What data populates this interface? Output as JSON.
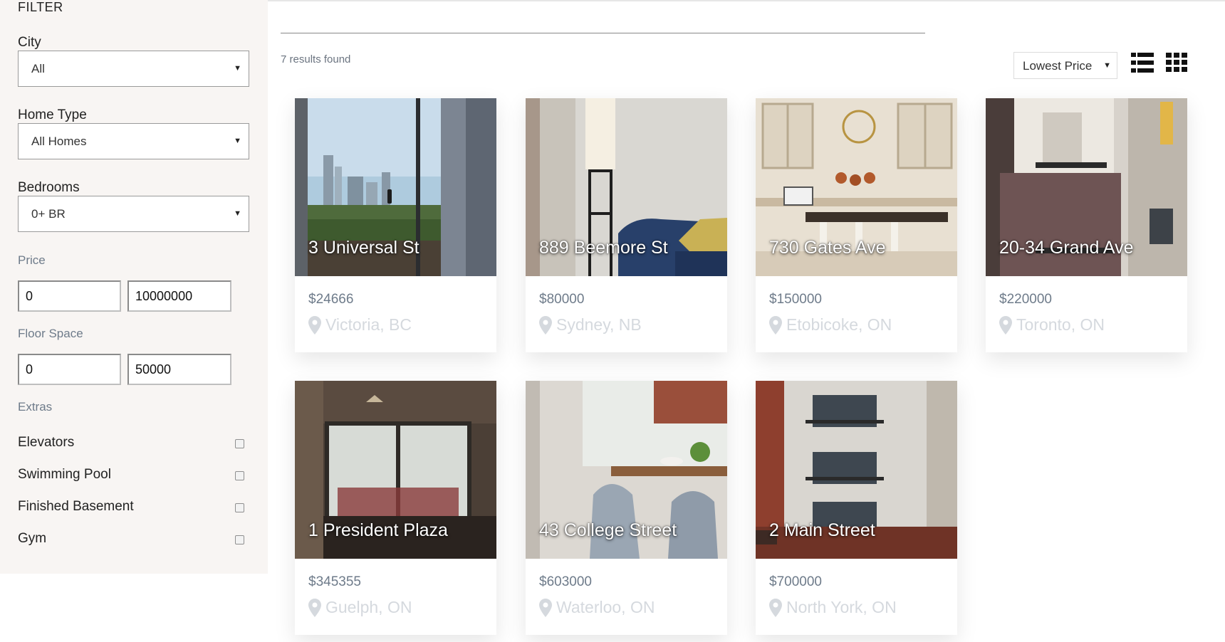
{
  "filter": {
    "heading": "FILTER",
    "city": {
      "label": "City",
      "value": "All"
    },
    "home_type": {
      "label": "Home Type",
      "value": "All Homes"
    },
    "bedrooms": {
      "label": "Bedrooms",
      "value": "0+ BR"
    },
    "price": {
      "label": "Price",
      "min": "0",
      "max": "10000000"
    },
    "floor_space": {
      "label": "Floor Space",
      "min": "0",
      "max": "50000"
    },
    "extras": {
      "label": "Extras",
      "items": [
        {
          "label": "Elevators",
          "checked": false
        },
        {
          "label": "Swimming Pool",
          "checked": false
        },
        {
          "label": "Finished Basement",
          "checked": false
        },
        {
          "label": "Gym",
          "checked": false
        }
      ]
    }
  },
  "main": {
    "results_text": "7 results found",
    "sort": {
      "value": "Lowest Price"
    },
    "view_icons": [
      "list-view-icon",
      "grid-view-icon"
    ]
  },
  "listings": [
    {
      "address": "3 Universal St",
      "price": "$24666",
      "location": "Victoria, BC"
    },
    {
      "address": "889 Beemore St",
      "price": "$80000",
      "location": "Sydney, NB"
    },
    {
      "address": "730 Gates Ave",
      "price": "$150000",
      "location": "Etobicoke, ON"
    },
    {
      "address": "20-34 Grand Ave",
      "price": "$220000",
      "location": "Toronto, ON"
    },
    {
      "address": "1 President Plaza",
      "price": "$345355",
      "location": "Guelph, ON"
    },
    {
      "address": "43 College Street",
      "price": "$603000",
      "location": "Waterloo, ON"
    },
    {
      "address": "2 Main Street",
      "price": "$700000",
      "location": "North York, ON"
    }
  ],
  "colors": {
    "sidebar_bg": "#f8f5f3",
    "muted_text": "#6e7b8a",
    "location_text": "#d5d9de"
  }
}
